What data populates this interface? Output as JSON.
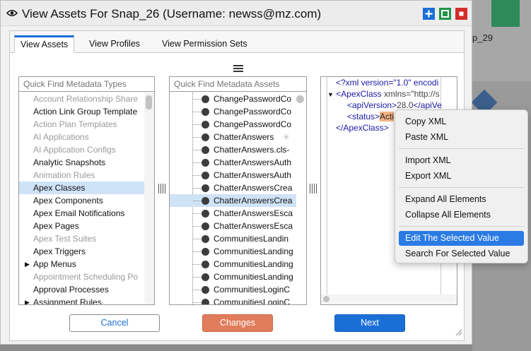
{
  "window": {
    "title": "View Assets For Snap_26 (Username: newss@mz.com)",
    "controls": [
      "maximize",
      "restore",
      "close"
    ]
  },
  "background": {
    "peek_label": "p_29"
  },
  "tabs": [
    {
      "label": "View Assets",
      "active": true
    },
    {
      "label": "View Profiles",
      "active": false
    },
    {
      "label": "View Permission Sets",
      "active": false
    }
  ],
  "types_panel": {
    "placeholder": "Quick Find Metadata Types",
    "items": [
      {
        "label": "Account Relationship Share",
        "dim": true
      },
      {
        "label": "Action Link Group Template",
        "dim": false
      },
      {
        "label": "Action Plan Templates",
        "dim": true
      },
      {
        "label": "AI Applications",
        "dim": true
      },
      {
        "label": "AI Application Configs",
        "dim": true
      },
      {
        "label": "Analytic Snapshots",
        "dim": false
      },
      {
        "label": "Animation Rules",
        "dim": true
      },
      {
        "label": "Apex Classes",
        "dim": false,
        "selected": true
      },
      {
        "label": "Apex Components",
        "dim": false
      },
      {
        "label": "Apex Email Notifications",
        "dim": false
      },
      {
        "label": "Apex Pages",
        "dim": false
      },
      {
        "label": "Apex Test Suites",
        "dim": true
      },
      {
        "label": "Apex Triggers",
        "dim": false
      },
      {
        "label": "App Menus",
        "dim": false,
        "expandable": true
      },
      {
        "label": "Appointment Scheduling Po",
        "dim": true
      },
      {
        "label": "Approval Processes",
        "dim": false
      },
      {
        "label": "Assignment Rules",
        "dim": false,
        "expandable": true
      }
    ]
  },
  "assets_panel": {
    "placeholder": "Quick Find Metadata Assets",
    "items": [
      {
        "label": "ChangePasswordCo"
      },
      {
        "label": "ChangePasswordCo"
      },
      {
        "label": "ChangePasswordCo"
      },
      {
        "label": "ChatterAnswers",
        "loading": true
      },
      {
        "label": "ChatterAnswers.cls-"
      },
      {
        "label": "ChatterAnswersAuth"
      },
      {
        "label": "ChatterAnswersAuth"
      },
      {
        "label": "ChatterAnswersCrea"
      },
      {
        "label": "ChatterAnswersCrea",
        "selected": true
      },
      {
        "label": "ChatterAnswersEsca"
      },
      {
        "label": "ChatterAnswersEsca"
      },
      {
        "label": "CommunitiesLandin"
      },
      {
        "label": "CommunitiesLanding"
      },
      {
        "label": "CommunitiesLanding"
      },
      {
        "label": "CommunitiesLanding"
      },
      {
        "label": "CommunitiesLoginC"
      },
      {
        "label": "CommunitiesLoginC"
      }
    ]
  },
  "xml_panel": {
    "line1": "<?xml version=\"1.0\" encodi",
    "line2_tag": "<ApexClass ",
    "line2_attr": "xmlns=\"http://s",
    "line3_open": "<apiVersion>",
    "line3_val": "28.0",
    "line3_close": "</apiVe",
    "line4_open": "<status>",
    "line4_val": "Acti",
    "line5": "</ApexClass>"
  },
  "buttons": {
    "cancel": "Cancel",
    "changes": "Changes",
    "next": "Next"
  },
  "context_menu": {
    "items": [
      {
        "label": "Copy XML"
      },
      {
        "label": "Paste XML"
      },
      {
        "label": "Import XML"
      },
      {
        "label": "Export XML"
      },
      {
        "label": "Expand All Elements"
      },
      {
        "label": "Collapse All Elements"
      },
      {
        "label": "Edit The Selected Value",
        "highlighted": true
      },
      {
        "label": "Search For Selected Value"
      }
    ]
  }
}
